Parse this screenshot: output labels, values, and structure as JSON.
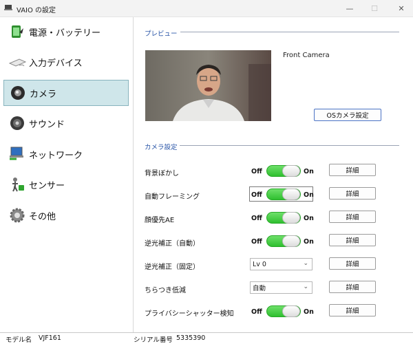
{
  "window": {
    "title": "VAIO の設定",
    "minimize": "—",
    "maximize": "☐",
    "close": "✕"
  },
  "sidebar": {
    "items": [
      {
        "label": "電源・バッテリー",
        "icon": "battery-icon"
      },
      {
        "label": "入力デバイス",
        "icon": "keyboard-icon"
      },
      {
        "label": "カメラ",
        "icon": "camera-icon",
        "selected": true
      },
      {
        "label": "サウンド",
        "icon": "speaker-icon"
      },
      {
        "label": "ネットワーク",
        "icon": "network-icon"
      },
      {
        "label": "センサー",
        "icon": "sensor-icon"
      },
      {
        "label": "その他",
        "icon": "gear-icon"
      }
    ]
  },
  "preview": {
    "header": "プレビュー",
    "camera_label": "Front Camera",
    "os_button": "OSカメラ設定"
  },
  "camera_settings": {
    "header": "カメラ設定",
    "off_label": "Off",
    "on_label": "On",
    "detail_label": "詳細",
    "rows": [
      {
        "label": "背景ぼかし",
        "control": "toggle",
        "state": "on"
      },
      {
        "label": "自動フレーミング",
        "control": "toggle",
        "state": "on",
        "focused": true
      },
      {
        "label": "顔優先AE",
        "control": "toggle",
        "state": "on"
      },
      {
        "label": "逆光補正（自動）",
        "control": "toggle",
        "state": "on"
      },
      {
        "label": "逆光補正（固定）",
        "control": "select",
        "value": "Lv 0"
      },
      {
        "label": "ちらつき低減",
        "control": "select",
        "value": "自動"
      },
      {
        "label": "プライバシーシャッター検知",
        "control": "toggle",
        "state": "on"
      }
    ]
  },
  "status": {
    "model_label": "モデル名",
    "model_value": "VJF161",
    "serial_label": "シリアル番号",
    "serial_value": "5335390"
  },
  "colors": {
    "toggle_on": "#34c534",
    "selected_bg": "#cfe6ea",
    "section_header": "#2a56a8"
  }
}
